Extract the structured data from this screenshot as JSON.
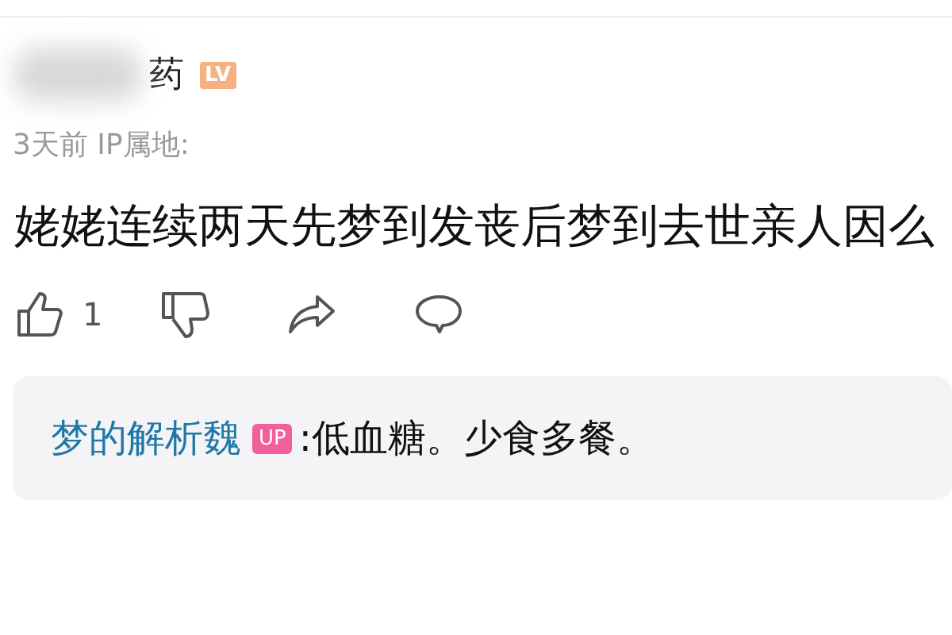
{
  "comment": {
    "user_name": "药",
    "level_badge": "LV",
    "meta": "3天前 IP属地:",
    "text": "姥姥连续两天先梦到发丧后梦到去世亲人因么",
    "likes": "1"
  },
  "reply": {
    "author": "梦的解析魏",
    "badge": "UP",
    "separator": ":",
    "text": "低血糖。少食多餐。"
  }
}
